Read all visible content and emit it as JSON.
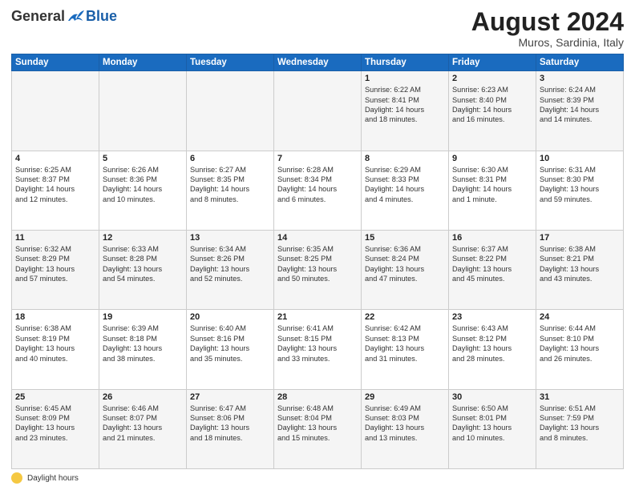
{
  "header": {
    "logo_general": "General",
    "logo_blue": "Blue",
    "month_year": "August 2024",
    "location": "Muros, Sardinia, Italy"
  },
  "days_of_week": [
    "Sunday",
    "Monday",
    "Tuesday",
    "Wednesday",
    "Thursday",
    "Friday",
    "Saturday"
  ],
  "weeks": [
    [
      {
        "day": "",
        "info": ""
      },
      {
        "day": "",
        "info": ""
      },
      {
        "day": "",
        "info": ""
      },
      {
        "day": "",
        "info": ""
      },
      {
        "day": "1",
        "info": "Sunrise: 6:22 AM\nSunset: 8:41 PM\nDaylight: 14 hours\nand 18 minutes."
      },
      {
        "day": "2",
        "info": "Sunrise: 6:23 AM\nSunset: 8:40 PM\nDaylight: 14 hours\nand 16 minutes."
      },
      {
        "day": "3",
        "info": "Sunrise: 6:24 AM\nSunset: 8:39 PM\nDaylight: 14 hours\nand 14 minutes."
      }
    ],
    [
      {
        "day": "4",
        "info": "Sunrise: 6:25 AM\nSunset: 8:37 PM\nDaylight: 14 hours\nand 12 minutes."
      },
      {
        "day": "5",
        "info": "Sunrise: 6:26 AM\nSunset: 8:36 PM\nDaylight: 14 hours\nand 10 minutes."
      },
      {
        "day": "6",
        "info": "Sunrise: 6:27 AM\nSunset: 8:35 PM\nDaylight: 14 hours\nand 8 minutes."
      },
      {
        "day": "7",
        "info": "Sunrise: 6:28 AM\nSunset: 8:34 PM\nDaylight: 14 hours\nand 6 minutes."
      },
      {
        "day": "8",
        "info": "Sunrise: 6:29 AM\nSunset: 8:33 PM\nDaylight: 14 hours\nand 4 minutes."
      },
      {
        "day": "9",
        "info": "Sunrise: 6:30 AM\nSunset: 8:31 PM\nDaylight: 14 hours\nand 1 minute."
      },
      {
        "day": "10",
        "info": "Sunrise: 6:31 AM\nSunset: 8:30 PM\nDaylight: 13 hours\nand 59 minutes."
      }
    ],
    [
      {
        "day": "11",
        "info": "Sunrise: 6:32 AM\nSunset: 8:29 PM\nDaylight: 13 hours\nand 57 minutes."
      },
      {
        "day": "12",
        "info": "Sunrise: 6:33 AM\nSunset: 8:28 PM\nDaylight: 13 hours\nand 54 minutes."
      },
      {
        "day": "13",
        "info": "Sunrise: 6:34 AM\nSunset: 8:26 PM\nDaylight: 13 hours\nand 52 minutes."
      },
      {
        "day": "14",
        "info": "Sunrise: 6:35 AM\nSunset: 8:25 PM\nDaylight: 13 hours\nand 50 minutes."
      },
      {
        "day": "15",
        "info": "Sunrise: 6:36 AM\nSunset: 8:24 PM\nDaylight: 13 hours\nand 47 minutes."
      },
      {
        "day": "16",
        "info": "Sunrise: 6:37 AM\nSunset: 8:22 PM\nDaylight: 13 hours\nand 45 minutes."
      },
      {
        "day": "17",
        "info": "Sunrise: 6:38 AM\nSunset: 8:21 PM\nDaylight: 13 hours\nand 43 minutes."
      }
    ],
    [
      {
        "day": "18",
        "info": "Sunrise: 6:38 AM\nSunset: 8:19 PM\nDaylight: 13 hours\nand 40 minutes."
      },
      {
        "day": "19",
        "info": "Sunrise: 6:39 AM\nSunset: 8:18 PM\nDaylight: 13 hours\nand 38 minutes."
      },
      {
        "day": "20",
        "info": "Sunrise: 6:40 AM\nSunset: 8:16 PM\nDaylight: 13 hours\nand 35 minutes."
      },
      {
        "day": "21",
        "info": "Sunrise: 6:41 AM\nSunset: 8:15 PM\nDaylight: 13 hours\nand 33 minutes."
      },
      {
        "day": "22",
        "info": "Sunrise: 6:42 AM\nSunset: 8:13 PM\nDaylight: 13 hours\nand 31 minutes."
      },
      {
        "day": "23",
        "info": "Sunrise: 6:43 AM\nSunset: 8:12 PM\nDaylight: 13 hours\nand 28 minutes."
      },
      {
        "day": "24",
        "info": "Sunrise: 6:44 AM\nSunset: 8:10 PM\nDaylight: 13 hours\nand 26 minutes."
      }
    ],
    [
      {
        "day": "25",
        "info": "Sunrise: 6:45 AM\nSunset: 8:09 PM\nDaylight: 13 hours\nand 23 minutes."
      },
      {
        "day": "26",
        "info": "Sunrise: 6:46 AM\nSunset: 8:07 PM\nDaylight: 13 hours\nand 21 minutes."
      },
      {
        "day": "27",
        "info": "Sunrise: 6:47 AM\nSunset: 8:06 PM\nDaylight: 13 hours\nand 18 minutes."
      },
      {
        "day": "28",
        "info": "Sunrise: 6:48 AM\nSunset: 8:04 PM\nDaylight: 13 hours\nand 15 minutes."
      },
      {
        "day": "29",
        "info": "Sunrise: 6:49 AM\nSunset: 8:03 PM\nDaylight: 13 hours\nand 13 minutes."
      },
      {
        "day": "30",
        "info": "Sunrise: 6:50 AM\nSunset: 8:01 PM\nDaylight: 13 hours\nand 10 minutes."
      },
      {
        "day": "31",
        "info": "Sunrise: 6:51 AM\nSunset: 7:59 PM\nDaylight: 13 hours\nand 8 minutes."
      }
    ]
  ],
  "legend": {
    "daylight_label": "Daylight hours"
  }
}
